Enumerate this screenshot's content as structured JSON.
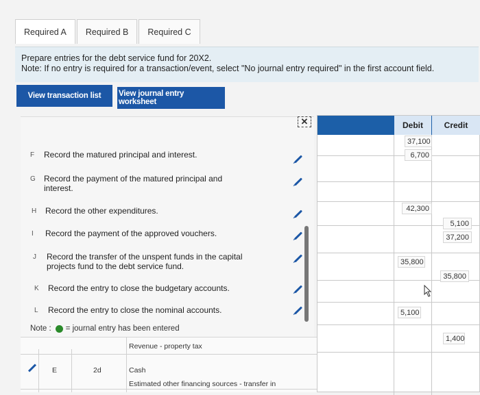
{
  "tabs": [
    {
      "label": "Required A"
    },
    {
      "label": "Required B"
    },
    {
      "label": "Required C"
    }
  ],
  "instructions": {
    "line1": "Prepare entries for the debt service fund for 20X2.",
    "line2": "Note: If no entry is required for a transaction/event, select \"No journal entry required\" in the first account field."
  },
  "buttons": {
    "view_transactions": "View transaction list",
    "view_worksheet": "View journal entry worksheet"
  },
  "transactions": [
    {
      "letter": "F",
      "text": "Record the matured principal and interest."
    },
    {
      "letter": "G",
      "text": "Record the payment of the matured principal and interest."
    },
    {
      "letter": "H",
      "text": "Record the other expenditures."
    },
    {
      "letter": "I",
      "text": "Record the payment of the approved vouchers."
    },
    {
      "letter": "J",
      "text": "Record the transfer of the unspent funds in the capital projects fund to the debt service fund."
    },
    {
      "letter": "K",
      "text": "Record the entry to close the budgetary accounts."
    },
    {
      "letter": "L",
      "text": "Record the entry to close the nominal accounts."
    }
  ],
  "grid": {
    "debit_header": "Debit",
    "credit_header": "Credit",
    "debit_values": [
      "37,100",
      "6,700",
      "42,300",
      "35,800",
      "5,100"
    ],
    "credit_values": [
      "5,100",
      "37,200",
      "35,800",
      "1,400"
    ]
  },
  "note": {
    "prefix": "Note :",
    "text": "= journal entry has been entered"
  },
  "bottom_table": {
    "account1": "Revenue - property tax",
    "row_label": "E",
    "row_date": "2d",
    "account2": "Cash",
    "account3": "Estimated other financing sources - transfer in"
  },
  "colors": {
    "accent": "#1c57a6",
    "entered_dot": "#2a8a2a",
    "header_bg": "#d9e6f4"
  }
}
